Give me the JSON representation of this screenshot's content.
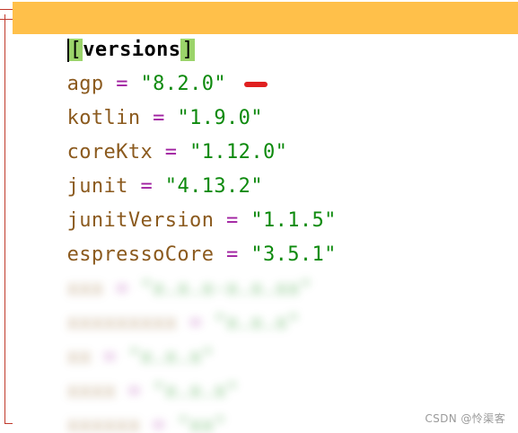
{
  "section": {
    "open_bracket": "[",
    "name": "versions",
    "close_bracket": "]"
  },
  "entries": [
    {
      "key": "agp",
      "eq": "=",
      "value": "\"8.2.0\""
    },
    {
      "key": "kotlin",
      "eq": "=",
      "value": "\"1.9.0\""
    },
    {
      "key": "coreKtx",
      "eq": "=",
      "value": "\"1.12.0\""
    },
    {
      "key": "junit",
      "eq": "=",
      "value": "\"4.13.2\""
    },
    {
      "key": "junitVersion",
      "eq": "=",
      "value": "\"1.1.5\""
    },
    {
      "key": "espressoCore",
      "eq": "=",
      "value": "\"3.5.1\""
    }
  ],
  "watermark": "CSDN @怜渠客",
  "colors": {
    "highlight_line": "#ffc04a",
    "bracket_match": "#9bd46a",
    "key": "#8b5a1e",
    "operator": "#a020a0",
    "string": "#0d8a0d",
    "fold_marker": "#c0392b",
    "annotation_mark": "#e02020"
  }
}
